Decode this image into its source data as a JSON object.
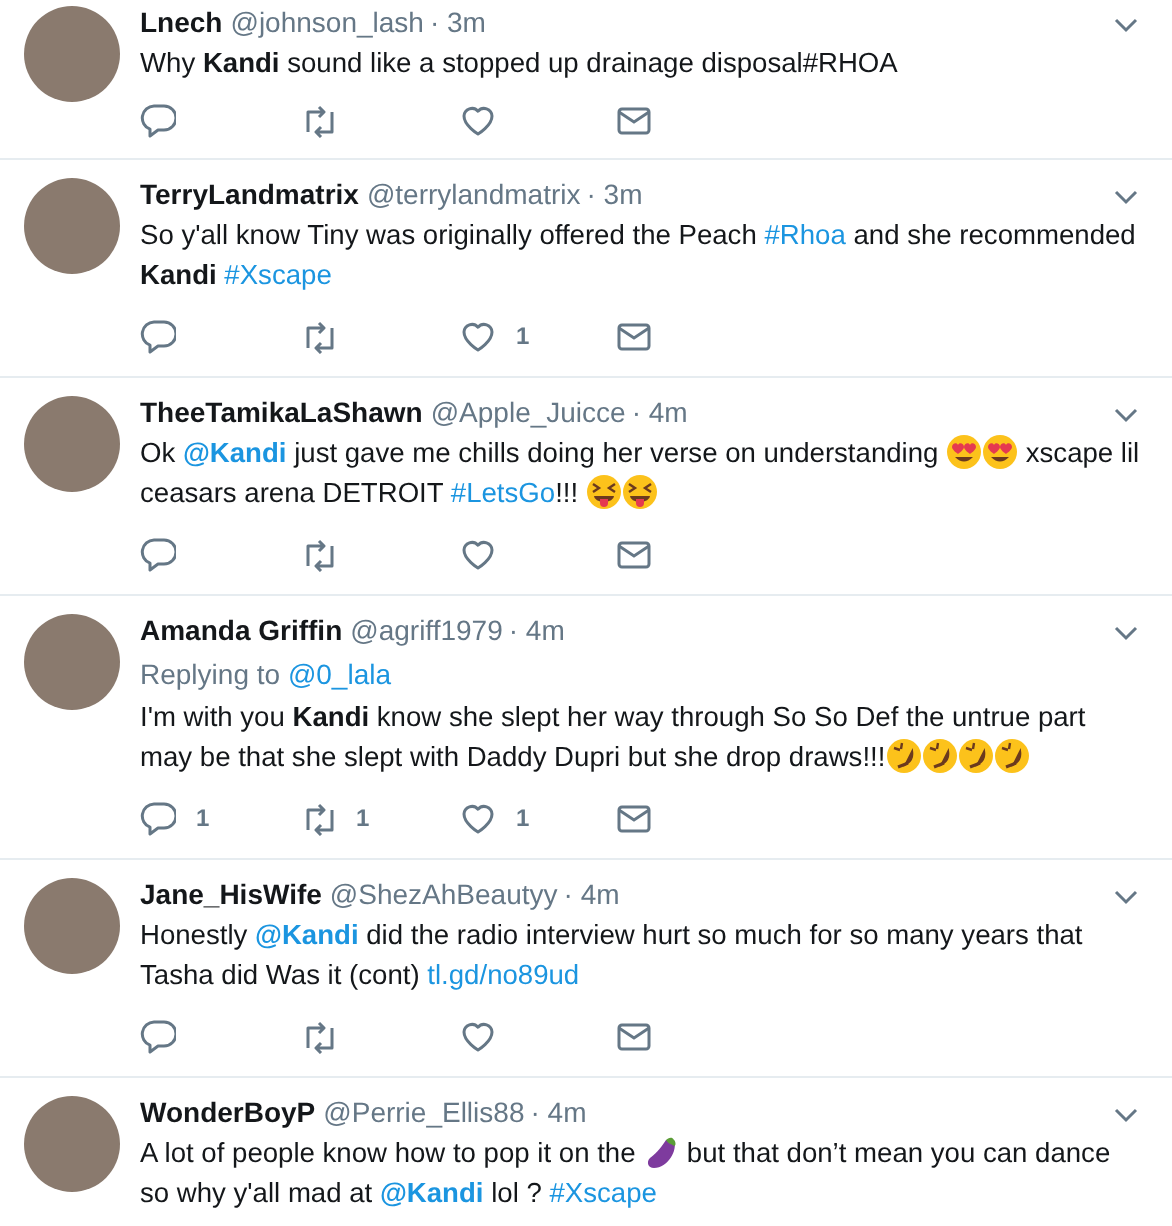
{
  "tweets": [
    {
      "name": "Lnech",
      "handle": "@johnson_lash",
      "time": "· 3m",
      "body": [
        {
          "kind": "text",
          "text": "Why "
        },
        {
          "kind": "strong",
          "text": "Kandi"
        },
        {
          "kind": "text",
          "text": " sound like a stopped up drainage disposal#RHOA"
        }
      ],
      "has_actions": true
    },
    {
      "name": "TerryLandmatrix",
      "handle": "@terrylandmatrix",
      "time": "· 3m",
      "body": [
        {
          "kind": "text",
          "text": "So y'all know Tiny was originally offered the Peach "
        },
        {
          "kind": "link",
          "text": "#Rhoa"
        },
        {
          "kind": "text",
          "text": " and she recommended "
        },
        {
          "kind": "strong",
          "text": "Kandi "
        },
        {
          "kind": "link",
          "text": "#Xscape"
        }
      ],
      "has_actions": true,
      "likes": "1"
    },
    {
      "name": "TheeTamikaLaShawn",
      "handle": "@Apple_Juicce",
      "time": "· 4m",
      "body": [
        {
          "kind": "text",
          "text": "Ok "
        },
        {
          "kind": "strong-link",
          "text": "@Kandi"
        },
        {
          "kind": "text",
          "text": " just gave me chills doing her verse on understanding "
        },
        {
          "kind": "emoji-heart-eyes"
        },
        {
          "kind": "emoji-heart-eyes"
        },
        {
          "kind": "text",
          "text": " xscape lil ceasars arena DETROIT "
        },
        {
          "kind": "link",
          "text": "#LetsGo"
        },
        {
          "kind": "text",
          "text": "!!! "
        },
        {
          "kind": "emoji-squint-tongue"
        },
        {
          "kind": "emoji-squint-tongue"
        }
      ],
      "has_actions": true
    },
    {
      "name": "Amanda Griffin",
      "handle": "@agriff1979",
      "time": "· 4m",
      "replying_label": "Replying to",
      "replying_to": "@0_lala",
      "body": [
        {
          "kind": "text",
          "text": "I'm with you "
        },
        {
          "kind": "strong",
          "text": "Kandi"
        },
        {
          "kind": "text",
          "text": " know she slept her way through So So Def the untrue part may be that she slept with Daddy Dupri but she drop draws!!!"
        },
        {
          "kind": "emoji-rofl"
        },
        {
          "kind": "emoji-rofl"
        },
        {
          "kind": "emoji-rofl"
        },
        {
          "kind": "emoji-rofl"
        }
      ],
      "has_actions": true,
      "replies": "1",
      "retweets": "1",
      "likes": "1"
    },
    {
      "name": "Jane_HisWife",
      "handle": "@ShezAhBeautyy",
      "time": "· 4m",
      "body": [
        {
          "kind": "text",
          "text": "Honestly "
        },
        {
          "kind": "strong-link",
          "text": "@Kandi"
        },
        {
          "kind": "text",
          "text": " did the radio interview hurt so much for so many years that Tasha did Was it (cont) "
        },
        {
          "kind": "link",
          "text": "tl.gd/no89ud"
        }
      ],
      "has_actions": true
    },
    {
      "name": "WonderBoyP",
      "handle": "@Perrie_Ellis88",
      "time": "· 4m",
      "body": [
        {
          "kind": "text",
          "text": "A lot of people know how to pop it on the "
        },
        {
          "kind": "emoji-eggplant"
        },
        {
          "kind": "text",
          "text": " but that don’t mean you can dance so why y'all mad at "
        },
        {
          "kind": "strong-link",
          "text": "@Kandi"
        },
        {
          "kind": "text",
          "text": " lol ? "
        },
        {
          "kind": "link",
          "text": "#Xscape"
        }
      ]
    }
  ]
}
